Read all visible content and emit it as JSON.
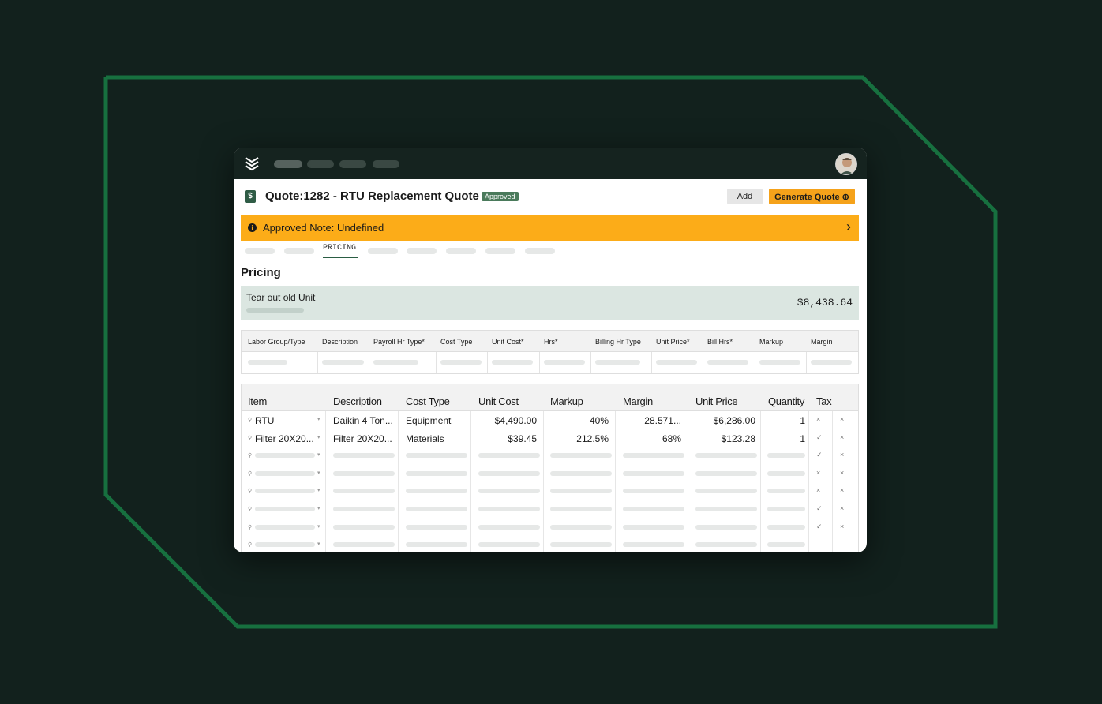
{
  "colors": {
    "background": "#12211d",
    "frame": "#17703f",
    "accent": "#f5a21a",
    "note": "#fcac18",
    "approved": "#4a7a5b",
    "labor_bg": "#dbe6e1"
  },
  "topbar": {
    "logo_icon": "stacked-chevrons-logo",
    "avatar": "user-avatar"
  },
  "header": {
    "quote_icon": "dollar-document-icon",
    "quote_icon_glyph": "$",
    "title": "Quote:1282 - RTU Replacement Quote",
    "status": "Approved",
    "add_label": "Add",
    "generate_label": "Generate Quote ⊕"
  },
  "note": {
    "icon": "i",
    "text": "Approved Note: Undefined",
    "chevron": "›"
  },
  "tabs": {
    "active": "PRICING"
  },
  "section": {
    "title": "Pricing"
  },
  "labor": {
    "title": "Tear out old Unit",
    "amount": "$8,438.64"
  },
  "labor_table": {
    "columns": [
      "Labor Group/Type",
      "Description",
      "Payroll Hr Type*",
      "Cost Type",
      "Unit Cost*",
      "Hrs*",
      "Billing Hr Type",
      "Unit Price*",
      "Bill Hrs*",
      "Markup",
      "Margin"
    ]
  },
  "items_table": {
    "columns": [
      "Item",
      "Description",
      "Cost Type",
      "Unit Cost",
      "Markup",
      "Margin",
      "Unit Price",
      "Quantity",
      "Tax"
    ],
    "rows": [
      {
        "item": "RTU",
        "description": "Daikin 4 Ton...",
        "cost_type": "Equipment",
        "unit_cost": "$4,490.00",
        "markup": "40%",
        "margin": "28.571...",
        "unit_price": "$6,286.00",
        "quantity": "1",
        "tax": "×",
        "remove": "×"
      },
      {
        "item": "Filter 20X20...",
        "description": "Filter 20X20...",
        "cost_type": "Materials",
        "unit_cost": "$39.45",
        "markup": "212.5%",
        "margin": "68%",
        "unit_price": "$123.28",
        "quantity": "1",
        "tax": "✓",
        "remove": "×"
      }
    ],
    "placeholder_rows": [
      {
        "tax": "✓",
        "remove": "×"
      },
      {
        "tax": "×",
        "remove": "×"
      },
      {
        "tax": "×",
        "remove": "×"
      },
      {
        "tax": "✓",
        "remove": "×"
      },
      {
        "tax": "✓",
        "remove": "×"
      },
      {
        "tax": "",
        "remove": ""
      }
    ]
  }
}
